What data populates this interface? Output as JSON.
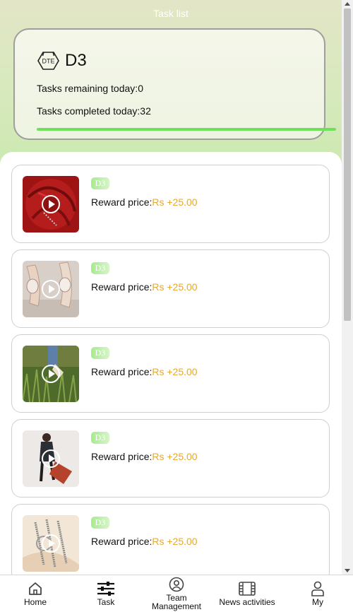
{
  "header": {
    "title": "Task list"
  },
  "summary": {
    "level_icon_text": "DTE",
    "level_name": "D3",
    "remaining_label": "Tasks remaining today:",
    "remaining_value": "0",
    "completed_label": "Tasks completed today:",
    "completed_value": "32",
    "progress_fraction": 1.0,
    "progress_color": "#6fe05a"
  },
  "tasks": [
    {
      "badge": "D3",
      "reward_label": "Reward price:",
      "reward_value": "Rs +25.00",
      "thumb": "red-rose"
    },
    {
      "badge": "D3",
      "reward_label": "Reward price:",
      "reward_value": "Rs +25.00",
      "thumb": "diamond-watches"
    },
    {
      "badge": "D3",
      "reward_label": "Reward price:",
      "reward_value": "Rs +25.00",
      "thumb": "grass-shoes"
    },
    {
      "badge": "D3",
      "reward_label": "Reward price:",
      "reward_value": "Rs +25.00",
      "thumb": "fashion-model"
    },
    {
      "badge": "D3",
      "reward_label": "Reward price:",
      "reward_value": "Rs +25.00",
      "thumb": "jewelry-rings"
    }
  ],
  "tabbar": {
    "items": [
      {
        "label": "Home",
        "icon": "home-icon"
      },
      {
        "label": "Task",
        "icon": "sliders-icon"
      },
      {
        "label": "Team Management",
        "icon": "user-circle-icon"
      },
      {
        "label": "News activities",
        "icon": "film-icon"
      },
      {
        "label": "My",
        "icon": "person-icon"
      }
    ]
  },
  "colors": {
    "accent": "#e8a92e",
    "badge": "#a7ea8f"
  }
}
